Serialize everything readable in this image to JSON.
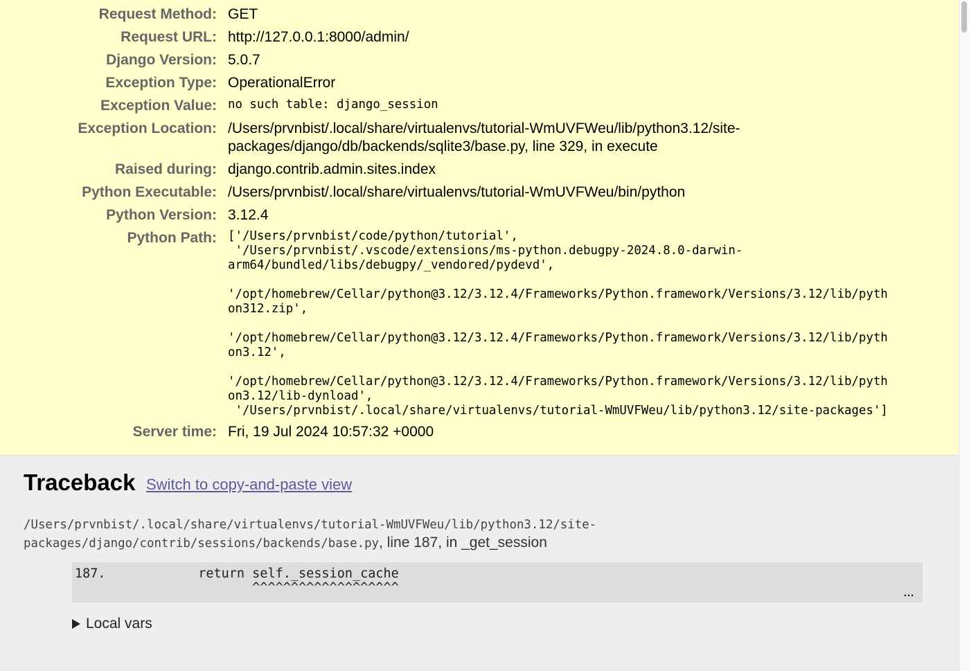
{
  "summary": {
    "rows": [
      {
        "label": "Request Method:",
        "value": "GET"
      },
      {
        "label": "Request URL:",
        "value": "http://127.0.0.1:8000/admin/"
      },
      {
        "label": "Django Version:",
        "value": "5.0.7"
      },
      {
        "label": "Exception Type:",
        "value": "OperationalError"
      },
      {
        "label": "Exception Value:",
        "value": "no such table: django_session"
      },
      {
        "label": "Exception Location:",
        "value": "/Users/prvnbist/.local/share/virtualenvs/tutorial-WmUVFWeu/lib/python3.12/site-packages/django/db/backends/sqlite3/base.py, line 329, in execute"
      },
      {
        "label": "Raised during:",
        "value": "django.contrib.admin.sites.index"
      },
      {
        "label": "Python Executable:",
        "value": "/Users/prvnbist/.local/share/virtualenvs/tutorial-WmUVFWeu/bin/python"
      },
      {
        "label": "Python Version:",
        "value": "3.12.4"
      },
      {
        "label": "Python Path:",
        "value": "['/Users/prvnbist/code/python/tutorial',\n '/Users/prvnbist/.vscode/extensions/ms-python.debugpy-2024.8.0-darwin-\narm64/bundled/libs/debugpy/_vendored/pydevd',\n\n'/opt/homebrew/Cellar/python@3.12/3.12.4/Frameworks/Python.framework/Versions/3.12/lib/pyth\non312.zip',\n\n'/opt/homebrew/Cellar/python@3.12/3.12.4/Frameworks/Python.framework/Versions/3.12/lib/pyth\non3.12',\n\n'/opt/homebrew/Cellar/python@3.12/3.12.4/Frameworks/Python.framework/Versions/3.12/lib/pyth\non3.12/lib-dynload',\n '/Users/prvnbist/.local/share/virtualenvs/tutorial-WmUVFWeu/lib/python3.12/site-packages']"
      },
      {
        "label": "Server time:",
        "value": "Fri, 19 Jul 2024 10:57:32 +0000"
      }
    ]
  },
  "traceback": {
    "title": "Traceback",
    "switch_link": "Switch to copy-and-paste view",
    "frame": {
      "path": "/Users/prvnbist/.local/share/virtualenvs/tutorial-WmUVFWeu/lib/python3.12/site-\npackages/django/contrib/sessions/backends/base.py",
      "line_info": ", line 187, in _get_session",
      "code_line": "187.            return self._session_cache",
      "carets": "                       ^^^^^^^^^^^^^^^^^^^",
      "ellipsis": "…",
      "local_vars": "Local vars"
    }
  }
}
